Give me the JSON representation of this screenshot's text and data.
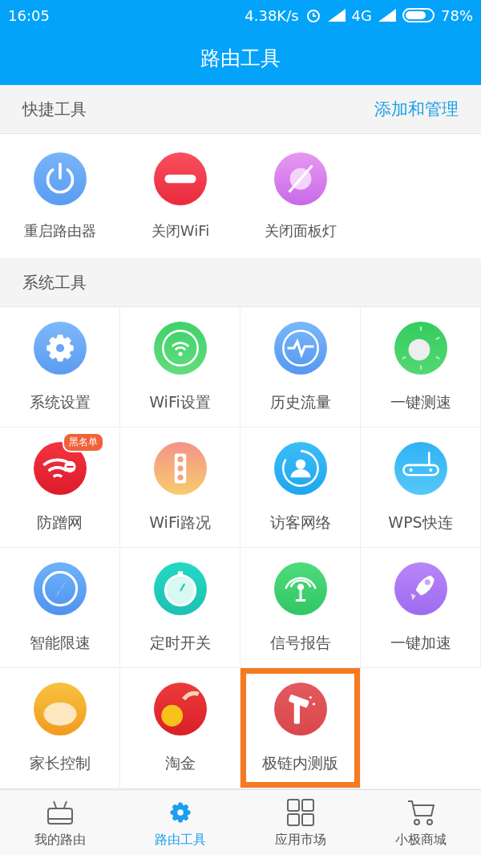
{
  "status_bar": {
    "time": "16:05",
    "speed": "4.38K/s",
    "network": "4G",
    "battery": {
      "text": "78%",
      "level": 0.78
    }
  },
  "title": "路由工具",
  "quick_tools": {
    "title": "快捷工具",
    "action": "添加和管理",
    "items": [
      {
        "label": "重启路由器"
      },
      {
        "label": "关闭WiFi"
      },
      {
        "label": "关闭面板灯"
      }
    ]
  },
  "system_tools": {
    "title": "系统工具",
    "items": [
      {
        "label": "系统设置",
        "highlighted": false
      },
      {
        "label": "WiFi设置",
        "highlighted": false
      },
      {
        "label": "历史流量",
        "highlighted": false
      },
      {
        "label": "一键测速",
        "highlighted": false
      },
      {
        "label": "防蹭网",
        "badge": "黑名单",
        "highlighted": false
      },
      {
        "label": "WiFi路况",
        "highlighted": false
      },
      {
        "label": "访客网络",
        "highlighted": false
      },
      {
        "label": "WPS快连",
        "highlighted": false
      },
      {
        "label": "智能限速",
        "highlighted": false
      },
      {
        "label": "定时开关",
        "highlighted": false
      },
      {
        "label": "信号报告",
        "highlighted": false
      },
      {
        "label": "一键加速",
        "highlighted": false
      },
      {
        "label": "家长控制",
        "highlighted": false
      },
      {
        "label": "淘金",
        "highlighted": false
      },
      {
        "label": "极链内测版",
        "highlighted": true
      }
    ]
  },
  "tab_bar": [
    {
      "label": "我的路由",
      "selected": false
    },
    {
      "label": "路由工具",
      "selected": true
    },
    {
      "label": "应用市场",
      "selected": false
    },
    {
      "label": "小极商城",
      "selected": false
    }
  ]
}
